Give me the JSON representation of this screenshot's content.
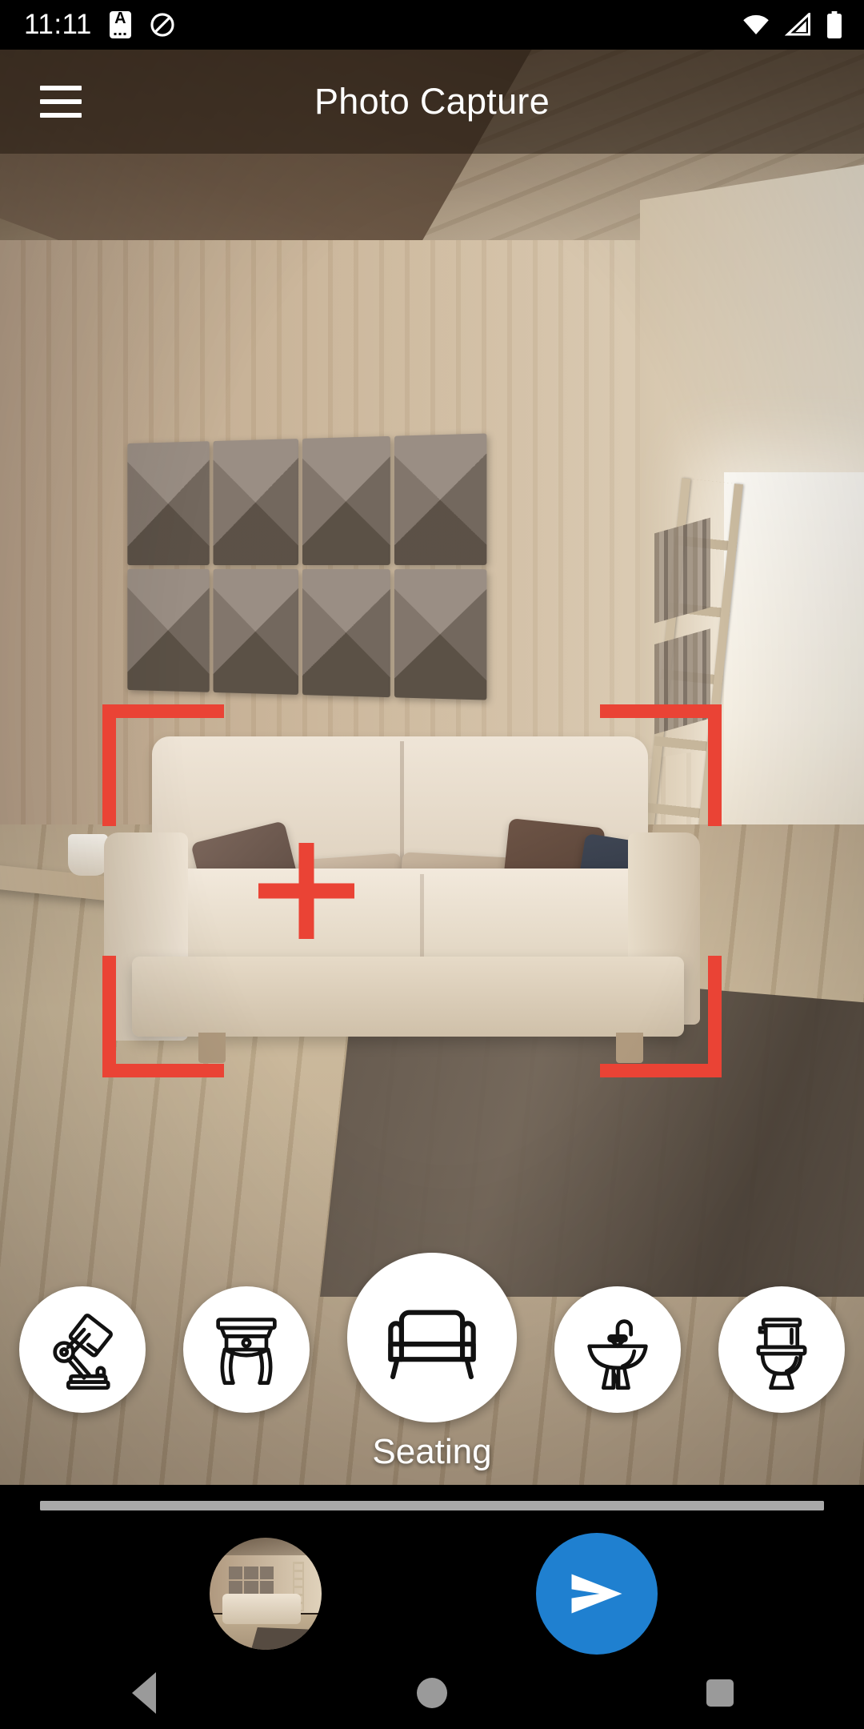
{
  "status_bar": {
    "time": "11:11",
    "icons": [
      "caption-a-icon",
      "do-not-disturb-icon",
      "wifi-icon",
      "cellular-signal-icon",
      "battery-icon"
    ]
  },
  "app_bar": {
    "menu_icon": "hamburger-menu-icon",
    "title": "Photo Capture"
  },
  "viewfinder": {
    "focus_frame_color": "#ea4335",
    "crosshair_icon": "crosshair-plus-icon",
    "scene_description": "living room with beige sofa"
  },
  "carousel": {
    "selected_label": "Seating",
    "items": [
      {
        "id": "lighting",
        "icon": "desk-lamp-icon",
        "selected": false
      },
      {
        "id": "tables",
        "icon": "side-table-icon",
        "selected": false
      },
      {
        "id": "seating",
        "icon": "sofa-icon",
        "selected": true
      },
      {
        "id": "sinks",
        "icon": "pedestal-sink-icon",
        "selected": false
      },
      {
        "id": "toilets",
        "icon": "toilet-icon",
        "selected": false
      }
    ]
  },
  "bottom_bar": {
    "progress_percent": 100,
    "progress_color": "#a9a9a9",
    "thumbnail_name": "last-capture-thumbnail",
    "send_button": {
      "icon": "send-arrow-icon",
      "color": "#1f80d0"
    }
  },
  "nav_bar": {
    "back_icon": "back-triangle-icon",
    "home_icon": "home-circle-icon",
    "recents_icon": "recents-square-icon"
  }
}
